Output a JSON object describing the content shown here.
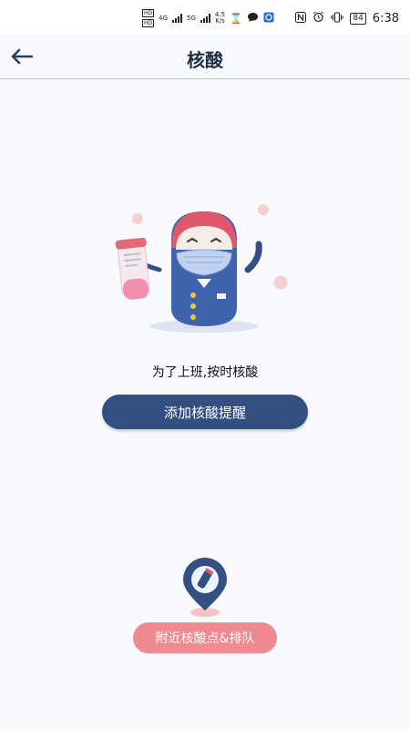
{
  "status_bar": {
    "hd1": "HD",
    "hd2": "HD",
    "net1": "4G",
    "net2": "5G",
    "speed_value": "4.5",
    "speed_unit": "K/s",
    "battery": "84",
    "time": "6:38"
  },
  "header": {
    "title": "核酸"
  },
  "main": {
    "slogan": "为了上班,按时核酸",
    "add_reminder_label": "添加核酸提醒",
    "nearby_label": "附近核酸点&排队"
  },
  "colors": {
    "primary": "#334f82",
    "nearby_button": "#ef8a90",
    "background": "#f7f9fc"
  }
}
